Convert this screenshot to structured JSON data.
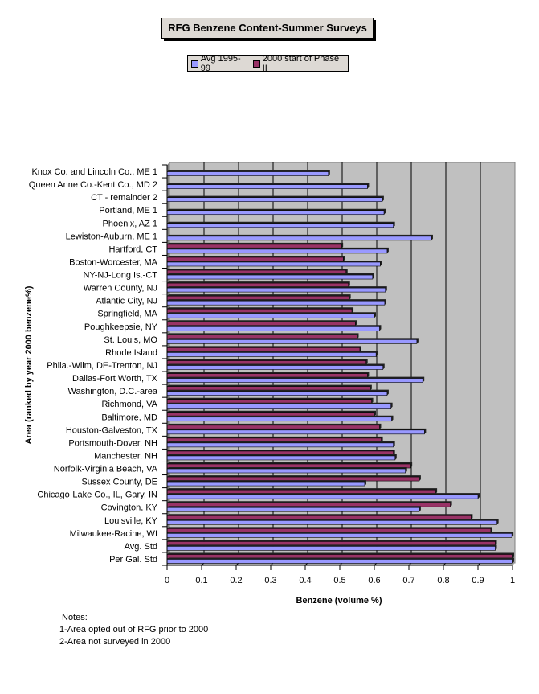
{
  "chart_data": {
    "type": "bar",
    "orientation": "horizontal",
    "title": "RFG Benzene Content-Summer Surveys",
    "xlabel": "Benzene (volume %)",
    "ylabel": "Area (ranked by year 2000 benzene%)",
    "xlim": [
      0,
      1
    ],
    "xticks": [
      "0",
      "0.1",
      "0.2",
      "0.3",
      "0.4",
      "0.5",
      "0.6",
      "0.7",
      "0.8",
      "0.9",
      "1"
    ],
    "grid": true,
    "legend_position": "top-center",
    "categories": [
      "Knox Co. and Lincoln Co., ME 1",
      "Queen Anne Co.-Kent Co., MD 2",
      "CT - remainder 2",
      "Portland, ME 1",
      "Phoenix, AZ 1",
      "Lewiston-Auburn, ME 1",
      "Hartford, CT",
      "Boston-Worcester, MA",
      "NY-NJ-Long Is.-CT",
      "Warren County, NJ",
      "Atlantic City, NJ",
      "Springfield, MA",
      "Poughkeepsie, NY",
      "St. Louis, MO",
      "Rhode Island",
      "Phila.-Wilm, DE-Trenton, NJ",
      "Dallas-Fort Worth, TX",
      "Washington, D.C.-area",
      "Richmond, VA",
      "Baltimore, MD",
      "Houston-Galveston, TX",
      "Portsmouth-Dover, NH",
      "Manchester, NH",
      "Norfolk-Virginia Beach, VA",
      "Sussex County, DE",
      "Chicago-Lake Co., IL, Gary, IN",
      "Covington, KY",
      "Louisville, KY",
      "Milwaukee-Racine, WI",
      "Avg. Std",
      "Per Gal. Std"
    ],
    "series": [
      {
        "name": "2000 start of Phase II",
        "color": "#993366",
        "values": [
          null,
          null,
          null,
          null,
          null,
          null,
          0.505,
          0.51,
          0.518,
          0.525,
          0.527,
          0.535,
          0.545,
          0.55,
          0.558,
          0.576,
          0.58,
          0.588,
          0.592,
          0.6,
          0.615,
          0.62,
          0.655,
          0.705,
          0.73,
          0.777,
          0.82,
          0.88,
          0.937,
          0.95,
          1.0
        ]
      },
      {
        "name": "Avg 1995-99",
        "color": "#9999ff",
        "values": [
          0.467,
          0.58,
          0.623,
          0.628,
          0.655,
          0.765,
          0.637,
          0.617,
          0.595,
          0.632,
          0.63,
          0.6,
          0.615,
          0.723,
          0.605,
          0.625,
          0.74,
          0.637,
          0.648,
          0.65,
          0.745,
          0.655,
          0.66,
          0.69,
          0.572,
          0.9,
          0.73,
          0.955,
          0.998,
          0.95,
          1.0
        ]
      }
    ],
    "plot_background": "#c0c0c0"
  },
  "legend": {
    "items": [
      {
        "label": "Avg 1995-99",
        "color": "#9999ff"
      },
      {
        "label": "2000 start of Phase II",
        "color": "#993366"
      }
    ]
  },
  "notes": {
    "heading": "Notes:",
    "lines": [
      "1-Area opted out of RFG prior to 2000",
      "2-Area not surveyed in 2000"
    ]
  }
}
